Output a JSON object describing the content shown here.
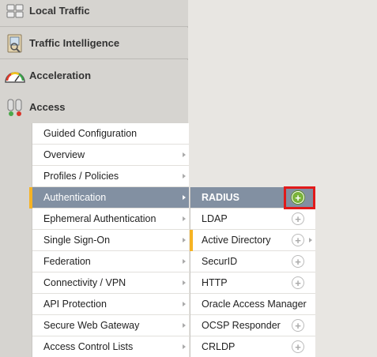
{
  "nav": {
    "items": [
      {
        "label": "Local Traffic",
        "icon": "local-traffic-icon"
      },
      {
        "label": "Traffic Intelligence",
        "icon": "traffic-intelligence-icon"
      },
      {
        "label": "Acceleration",
        "icon": "acceleration-gauge-icon"
      },
      {
        "label": "Access",
        "icon": "access-icon"
      }
    ]
  },
  "access_menu": {
    "items": [
      {
        "label": "Guided Configuration",
        "has_arrow": false
      },
      {
        "label": "Overview",
        "has_arrow": true
      },
      {
        "label": "Profiles / Policies",
        "has_arrow": true
      },
      {
        "label": "Authentication",
        "has_arrow": true,
        "active": true
      },
      {
        "label": "Ephemeral Authentication",
        "has_arrow": true
      },
      {
        "label": "Single Sign-On",
        "has_arrow": true
      },
      {
        "label": "Federation",
        "has_arrow": true
      },
      {
        "label": "Connectivity / VPN",
        "has_arrow": true
      },
      {
        "label": "API Protection",
        "has_arrow": true
      },
      {
        "label": "Secure Web Gateway",
        "has_arrow": true
      },
      {
        "label": "Access Control Lists",
        "has_arrow": true
      }
    ]
  },
  "auth_menu": {
    "items": [
      {
        "label": "RADIUS",
        "has_plus": true,
        "active": true
      },
      {
        "label": "LDAP",
        "has_plus": true
      },
      {
        "label": "Active Directory",
        "has_plus": true,
        "has_arrow": true,
        "marked": true
      },
      {
        "label": "SecurID",
        "has_plus": true
      },
      {
        "label": "HTTP",
        "has_plus": true
      },
      {
        "label": "Oracle Access Manager",
        "has_plus": false
      },
      {
        "label": "OCSP Responder",
        "has_plus": true
      },
      {
        "label": "CRLDP",
        "has_plus": true
      }
    ]
  },
  "colors": {
    "active_bg": "#8290a2",
    "accent_orange": "#f6b323",
    "plus_green": "#7ab33a",
    "highlight_red": "#e11a1a"
  }
}
